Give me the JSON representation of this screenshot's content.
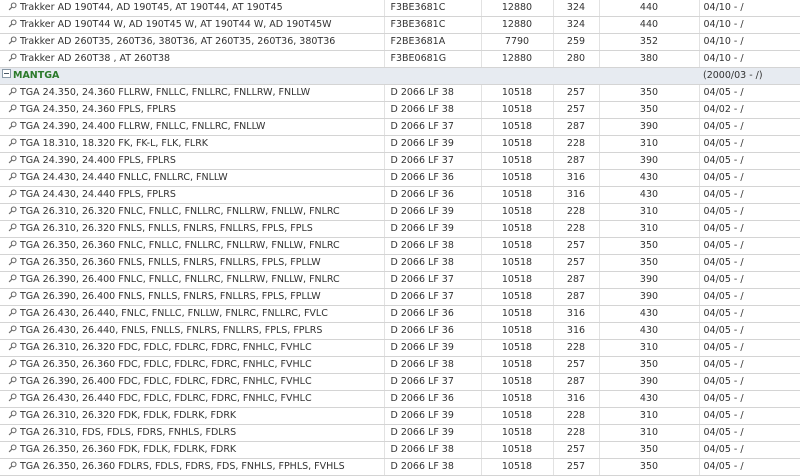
{
  "brand": {
    "name": "MAN",
    "subgroup": "TGA",
    "years": "(2000/03 - /)"
  },
  "rows_before": [
    {
      "model": "Trakker AD 190T44, AD 190T45, AT 190T44, AT 190T45",
      "code": "F3BE3681C",
      "ccm": "12880",
      "kw": "324",
      "hp": "440",
      "year": "04/10 - /"
    },
    {
      "model": "Trakker AD 190T44 W, AD 190T45 W, AT 190T44 W, AD 190T45W",
      "code": "F3BE3681C",
      "ccm": "12880",
      "kw": "324",
      "hp": "440",
      "year": "04/10 - /"
    },
    {
      "model": "Trakker AD 260T35, 260T36, 380T36, AT 260T35, 260T36, 380T36",
      "code": "F2BE3681A",
      "ccm": "7790",
      "kw": "259",
      "hp": "352",
      "year": "04/10 - /"
    },
    {
      "model": "Trakker AD 260T38 , AT 260T38",
      "code": "F3BE0681G",
      "ccm": "12880",
      "kw": "280",
      "hp": "380",
      "year": "04/10 - /"
    }
  ],
  "rows_after": [
    {
      "model": "TGA 24.350, 24.360 FLLRW, FNLLC, FNLLRC, FNLLRW, FNLLW",
      "code": "D 2066 LF 38",
      "ccm": "10518",
      "kw": "257",
      "hp": "350",
      "year": "04/05 - /"
    },
    {
      "model": "TGA 24.350, 24.360 FPLS, FPLRS",
      "code": "D 2066 LF 38",
      "ccm": "10518",
      "kw": "257",
      "hp": "350",
      "year": "04/02 - /"
    },
    {
      "model": "TGA 24.390, 24.400 FLLRW, FNLLC, FNLLRC, FNLLW",
      "code": "D 2066 LF 37",
      "ccm": "10518",
      "kw": "287",
      "hp": "390",
      "year": "04/05 - /"
    },
    {
      "model": "TGA 18.310, 18.320 FK, FK-L, FLK, FLRK",
      "code": "D 2066 LF 39",
      "ccm": "10518",
      "kw": "228",
      "hp": "310",
      "year": "04/05 - /"
    },
    {
      "model": "TGA 24.390, 24.400 FPLS, FPLRS",
      "code": "D 2066 LF 37",
      "ccm": "10518",
      "kw": "287",
      "hp": "390",
      "year": "04/05 - /"
    },
    {
      "model": "TGA 24.430, 24.440 FNLLC, FNLLRC, FNLLW",
      "code": "D 2066 LF 36",
      "ccm": "10518",
      "kw": "316",
      "hp": "430",
      "year": "04/05 - /"
    },
    {
      "model": "TGA 24.430, 24.440 FPLS, FPLRS",
      "code": "D 2066 LF 36",
      "ccm": "10518",
      "kw": "316",
      "hp": "430",
      "year": "04/05 - /"
    },
    {
      "model": "TGA 26.310, 26.320 FNLC, FNLLC, FNLLRC, FNLLRW, FNLLW, FNLRC",
      "code": "D 2066 LF 39",
      "ccm": "10518",
      "kw": "228",
      "hp": "310",
      "year": "04/05 - /"
    },
    {
      "model": "TGA 26.310, 26.320 FNLS, FNLLS, FNLRS, FNLLRS, FPLS, FPLS",
      "code": "D 2066 LF 39",
      "ccm": "10518",
      "kw": "228",
      "hp": "310",
      "year": "04/05 - /"
    },
    {
      "model": "TGA 26.350, 26.360 FNLC, FNLLC, FNLLRC, FNLLRW, FNLLW, FNLRC",
      "code": "D 2066 LF 38",
      "ccm": "10518",
      "kw": "257",
      "hp": "350",
      "year": "04/05 - /"
    },
    {
      "model": "TGA 26.350, 26.360 FNLS, FNLLS, FNLRS, FNLLRS, FPLS, FPLLW",
      "code": "D 2066 LF 38",
      "ccm": "10518",
      "kw": "257",
      "hp": "350",
      "year": "04/05 - /"
    },
    {
      "model": "TGA 26.390, 26.400 FNLC, FNLLC, FNLLRC, FNLLRW, FNLLW, FNLRC",
      "code": "D 2066 LF 37",
      "ccm": "10518",
      "kw": "287",
      "hp": "390",
      "year": "04/05 - /"
    },
    {
      "model": "TGA 26.390, 26.400 FNLS, FNLLS, FNLRS, FNLLRS, FPLS, FPLLW",
      "code": "D 2066 LF 37",
      "ccm": "10518",
      "kw": "287",
      "hp": "390",
      "year": "04/05 - /"
    },
    {
      "model": "TGA 26.430, 26.440, FNLC, FNLLC, FNLLW, FNLRC, FNLLRC, FVLC",
      "code": "D 2066 LF 36",
      "ccm": "10518",
      "kw": "316",
      "hp": "430",
      "year": "04/05 - /"
    },
    {
      "model": "TGA 26.430, 26.440, FNLS, FNLLS, FNLRS, FNLLRS, FPLS, FPLRS",
      "code": "D 2066 LF 36",
      "ccm": "10518",
      "kw": "316",
      "hp": "430",
      "year": "04/05 - /"
    },
    {
      "model": "TGA 26.310, 26.320 FDC, FDLC, FDLRC, FDRC, FNHLC, FVHLC",
      "code": "D 2066 LF 39",
      "ccm": "10518",
      "kw": "228",
      "hp": "310",
      "year": "04/05 - /"
    },
    {
      "model": "TGA 26.350, 26.360 FDC, FDLC, FDLRC, FDRC, FNHLC, FVHLC",
      "code": "D 2066 LF 38",
      "ccm": "10518",
      "kw": "257",
      "hp": "350",
      "year": "04/05 - /"
    },
    {
      "model": "TGA 26.390, 26.400 FDC, FDLC, FDLRC, FDRC, FNHLC, FVHLC",
      "code": "D 2066 LF 37",
      "ccm": "10518",
      "kw": "287",
      "hp": "390",
      "year": "04/05 - /"
    },
    {
      "model": "TGA 26.430, 26.440 FDC, FDLC, FDLRC, FDRC, FNHLC, FVHLC",
      "code": "D 2066 LF 36",
      "ccm": "10518",
      "kw": "316",
      "hp": "430",
      "year": "04/05 - /"
    },
    {
      "model": "TGA 26.310, 26.320 FDK, FDLK, FDLRK, FDRK",
      "code": "D 2066 LF 39",
      "ccm": "10518",
      "kw": "228",
      "hp": "310",
      "year": "04/05 - /"
    },
    {
      "model": "TGA 26.310, FDS, FDLS, FDRS, FNHLS, FDLRS",
      "code": "D 2066 LF 39",
      "ccm": "10518",
      "kw": "228",
      "hp": "310",
      "year": "04/05 - /"
    },
    {
      "model": "TGA 26.350, 26.360 FDK, FDLK, FDLRK, FDRK",
      "code": "D 2066 LF 38",
      "ccm": "10518",
      "kw": "257",
      "hp": "350",
      "year": "04/05 - /"
    },
    {
      "model": "TGA 26.350, 26.360 FDLRS, FDLS, FDRS, FDS, FNHLS, FPHLS, FVHLS",
      "code": "D 2066 LF 38",
      "ccm": "10518",
      "kw": "257",
      "hp": "350",
      "year": "04/05 - /"
    }
  ]
}
